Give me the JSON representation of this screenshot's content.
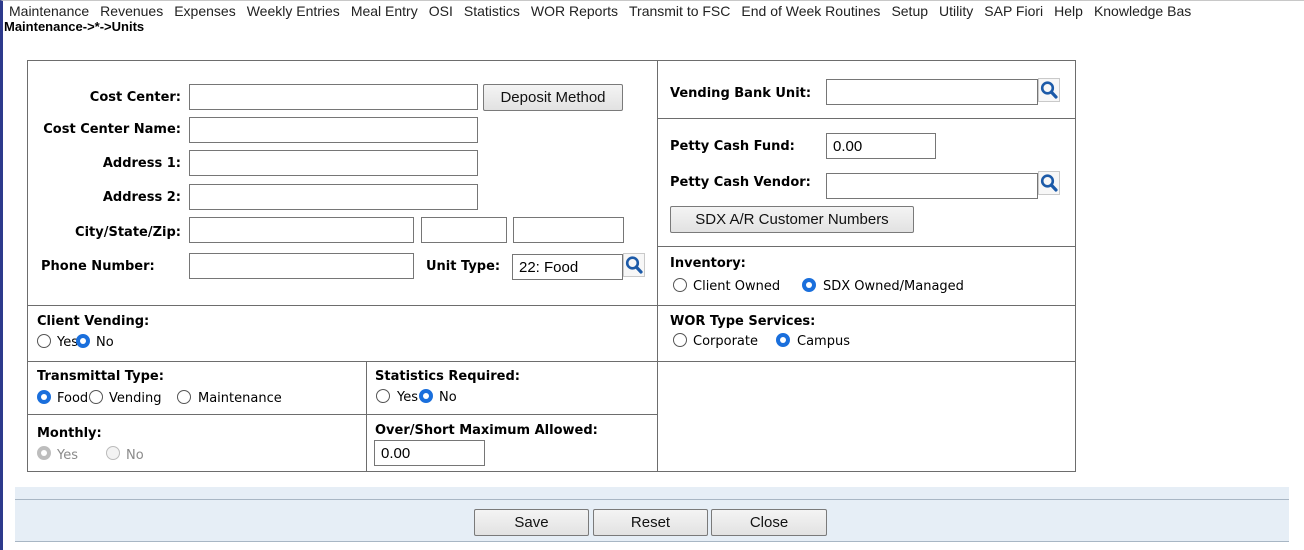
{
  "menu": [
    "Maintenance",
    "Revenues",
    "Expenses",
    "Weekly Entries",
    "Meal Entry",
    "OSI",
    "Statistics",
    "WOR Reports",
    "Transmit to FSC",
    "End of Week Routines",
    "Setup",
    "Utility",
    "SAP Fiori",
    "Help",
    "Knowledge Bas"
  ],
  "breadcrumb": "Maintenance->*->Units",
  "unit": {
    "cost_center_label": "Cost Center:",
    "cost_center_value": "",
    "deposit_method_label": "Deposit Method",
    "cost_center_name_label": "Cost Center Name:",
    "cost_center_name_value": "",
    "address1_label": "Address 1:",
    "address1_value": "",
    "address2_label": "Address 2:",
    "address2_value": "",
    "city_state_zip_label": "City/State/Zip:",
    "city_value": "",
    "state_value": "",
    "zip_value": "",
    "phone_label": "Phone Number:",
    "phone_value": "",
    "unit_type_label": "Unit Type:",
    "unit_type_value": "22: Food"
  },
  "right": {
    "vending_bank_label": "Vending Bank Unit:",
    "vending_bank_value": "",
    "petty_cash_fund_label": "Petty Cash Fund:",
    "petty_cash_fund_value": "0.00",
    "petty_cash_vendor_label": "Petty Cash Vendor:",
    "petty_cash_vendor_value": "",
    "sdx_button_label": "SDX A/R Customer Numbers",
    "inventory_label": "Inventory:",
    "inventory_options": [
      "Client Owned",
      "SDX Owned/Managed"
    ],
    "inventory_selected": "SDX Owned/Managed"
  },
  "client_vending": {
    "label": "Client Vending:",
    "options": [
      "Yes",
      "No"
    ],
    "selected": "No"
  },
  "wor_type": {
    "label": "WOR Type Services:",
    "options": [
      "Corporate",
      "Campus"
    ],
    "selected": "Campus"
  },
  "transmittal": {
    "label": "Transmittal Type:",
    "options": [
      "Food",
      "Vending",
      "Maintenance"
    ],
    "selected": "Food"
  },
  "statistics": {
    "label": "Statistics Required:",
    "options": [
      "Yes",
      "No"
    ],
    "selected": "No"
  },
  "monthly": {
    "label": "Monthly:",
    "options": [
      "Yes",
      "No"
    ],
    "selected": "Yes",
    "disabled": true
  },
  "over_short": {
    "label": "Over/Short Maximum Allowed:",
    "value": "0.00"
  },
  "footer": {
    "save": "Save",
    "reset": "Reset",
    "close": "Close"
  }
}
